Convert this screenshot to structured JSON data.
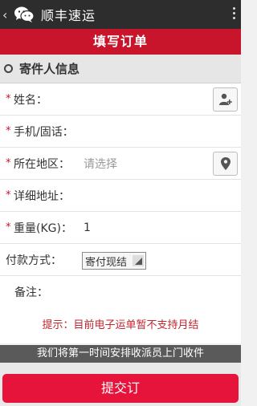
{
  "topbar": {
    "back": "‹",
    "title": "顺丰速运"
  },
  "header": {
    "title": "填写订单"
  },
  "section": {
    "title": "寄件人信息"
  },
  "form": {
    "name": {
      "label": "姓名："
    },
    "phone": {
      "label": "手机/固话："
    },
    "region": {
      "label": "所在地区：",
      "placeholder": "请选择"
    },
    "address": {
      "label": "详细地址："
    },
    "weight": {
      "label": "重量(KG)：",
      "value": "1"
    },
    "payment": {
      "label": "付款方式：",
      "selected": "寄付现结"
    },
    "notes": {
      "label": "备注："
    }
  },
  "tip": "提示：目前电子运单暂不支持月结",
  "bottom_note": "我们将第一时间安排收派员上门收件",
  "submit_label": "提交订",
  "colors": {
    "brand_red": "#c9152b",
    "button_red": "#e6143a",
    "topbar": "#2d2d2d"
  },
  "icons": {
    "contact": "add-contact-icon",
    "location": "location-pin-icon",
    "app": "wechat-logo-icon"
  }
}
